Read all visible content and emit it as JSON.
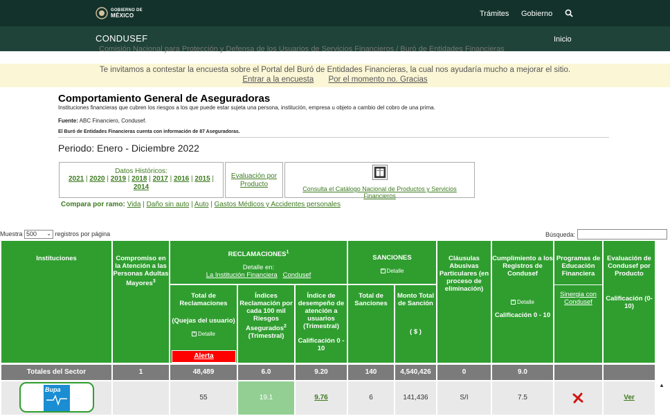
{
  "gov": {
    "logo_line1": "GOBIERNO DE",
    "logo_line2": "MÉXICO",
    "nav_tramites": "Trámites",
    "nav_gobierno": "Gobierno"
  },
  "sub": {
    "title": "CONDUSEF",
    "inicio": "Inicio"
  },
  "breadcrumb": "Comisión Nacional para Protección y Defensa de los Usuarios de Servicios Financieros / Buró de Entidades Financieras",
  "survey": {
    "message": "Te invitamos a contestar la encuesta sobre el Portal del Buró de Entidades Financieras, la cual nos ayudaría mucho a mejorar el sitio.",
    "enter": "Entrar a la encuesta",
    "decline": "Por el momento no. Gracias"
  },
  "header": {
    "title": "Comportamiento General de Aseguradoras",
    "description": "Instituciones financieras que cubren los riesgos a los que puede estar sujeta una persona, institución, empresa u objeto a cambio del cobro de una prima.",
    "fuente_label": "Fuente:",
    "fuente_value": "ABC Financiero, Condusef.",
    "count_note": "El Buró de Entidades Financieras cuenta con información de 87 Aseguradoras.",
    "periodo": "Periodo: Enero - Diciembre 2022"
  },
  "historicos": {
    "label": "Datos Históricos:",
    "years": [
      "2021",
      "2020",
      "2019",
      "2018",
      "2017",
      "2016",
      "2015",
      "2014"
    ]
  },
  "evaluacion_producto": "Evaluación por Producto",
  "catalogo": "Consulta el Catálogo Nacional de Productos y Servicios Financieros",
  "compara": {
    "label": "Compara por ramo:",
    "ramos": [
      "Vida",
      "Daño sin auto",
      "Auto",
      "Gastos Médicos y Accidentes personales"
    ]
  },
  "controls": {
    "muestra": "Muestra",
    "page_size": "500",
    "registros": "registros por página",
    "busqueda": "Búsqueda:"
  },
  "table": {
    "h_instituciones": "Instituciones",
    "h_compromiso": "Compromiso en la Atención a las Personas Adultas Mayores",
    "h_compromiso_sup": "3",
    "h_reclamaciones": "RECLAMACIONES",
    "h_reclamaciones_sup": "1",
    "h_detalle_en": "Detalle en:",
    "h_la_institucion": "La Institución Financiera",
    "h_condusef": "Condusef",
    "h_total_recl": "Total de Reclamaciones",
    "h_quejas": "(Quejas del usuario)",
    "h_detalle": "Detalle",
    "h_alerta": "Alerta",
    "h_indices": "Índices Reclamación por cada 100 mil Riesgos Asegurados",
    "h_indices_sup": "2",
    "h_trimestral": "(Trimestral)",
    "h_indice_desemp": "Índice de desempeño de atención a usuarios",
    "h_calificacion_010": "Calificación 0 - 10",
    "h_sanciones": "SANCIONES",
    "h_total_sanciones": "Total de Sanciones",
    "h_monto": "Monto Total de Sanción",
    "h_pesos": "( $ )",
    "h_clausulas": "Cláusulas Abusivas Particulares (en proceso de eliminación)",
    "h_cumplimiento": "Cumplimiento a los Registros de Condusef",
    "h_programas": "Programas de Educación Financiera",
    "h_sinergia": "Sinergia con Condusef",
    "h_evaluacion": "Evaluación de Condusef por Producto",
    "h_calificacion_paren": "Calificación (0-10)",
    "totals": {
      "label": "Totales del Sector",
      "compromiso": "1",
      "reclamaciones": "48,489",
      "indice": "6.0",
      "desempeno": "9.20",
      "sanciones": "140",
      "monto": "4,540,426",
      "clausulas": "0",
      "cumplimiento": "9.0"
    },
    "rows": [
      {
        "logo_text": "Bupa",
        "reclamaciones": "55",
        "indice": "19.1",
        "desempeno": "9.76",
        "sanciones": "6",
        "monto": "141,436",
        "clausulas": "S/I",
        "cumplimiento": "7.5",
        "evaluacion": "Ver"
      }
    ]
  }
}
